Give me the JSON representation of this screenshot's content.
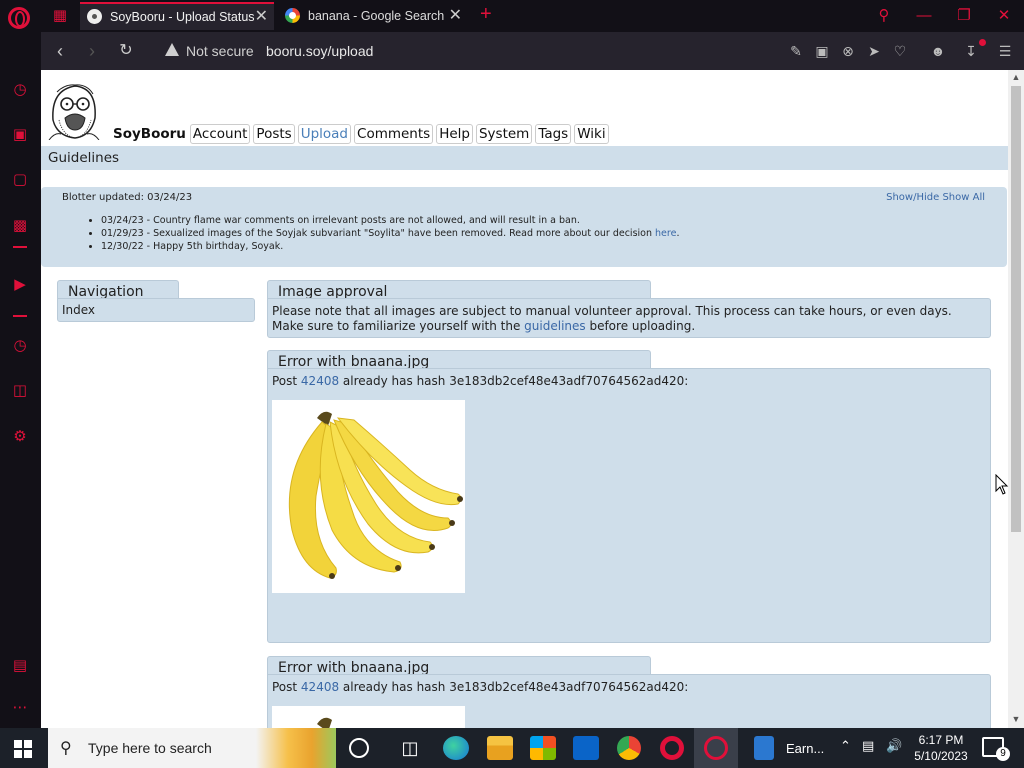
{
  "browser": {
    "tabs": [
      {
        "title": "SoyBooru - Upload Status",
        "active": true
      },
      {
        "title": "banana - Google Search",
        "active": false
      }
    ],
    "address": {
      "security": "Not secure",
      "url": "booru.soy/upload"
    },
    "accent_color": "#e0103a"
  },
  "site": {
    "name": "SoyBooru",
    "menu": [
      "Account",
      "Posts",
      "Upload",
      "Comments",
      "Help",
      "System",
      "Tags",
      "Wiki"
    ],
    "selected_menu": "Upload",
    "section_title": "Guidelines"
  },
  "blotter": {
    "title": "Blotter updated: 03/24/23",
    "controls": "Show/Hide Show All",
    "entries": [
      {
        "text": "03/24/23 - Country flame war comments on irrelevant posts are not allowed, and will result in a ban."
      },
      {
        "text": "01/29/23 - Sexualized images of the Soyjak subvariant \"Soylita\" have been removed. Read more about our decision ",
        "link": "here",
        "after": "."
      },
      {
        "text": "12/30/22 - Happy 5th birthday, Soyak."
      }
    ]
  },
  "navigation": {
    "title": "Navigation",
    "items": [
      "Index"
    ]
  },
  "approval": {
    "title": "Image approval",
    "line1": "Please note that all images are subject to manual volunteer approval. This process can take hours, or even days.",
    "line2_before": "Make sure to familiarize yourself with the ",
    "line2_link": "guidelines",
    "line2_after": " before uploading."
  },
  "errors": [
    {
      "title": "Error with bnaana.jpg",
      "prefix": "Post ",
      "post_id": "42408",
      "suffix": " already has hash 3e183db2cef48e43adf70764562ad420:"
    },
    {
      "title": "Error with bnaana.jpg",
      "prefix": "Post ",
      "post_id": "42408",
      "suffix": " already has hash 3e183db2cef48e43adf70764562ad420:"
    }
  ],
  "taskbar": {
    "search_placeholder": "Type here to search",
    "running_app_label": "Earn...",
    "time": "6:17 PM",
    "date": "5/10/2023",
    "notification_count": "9"
  }
}
